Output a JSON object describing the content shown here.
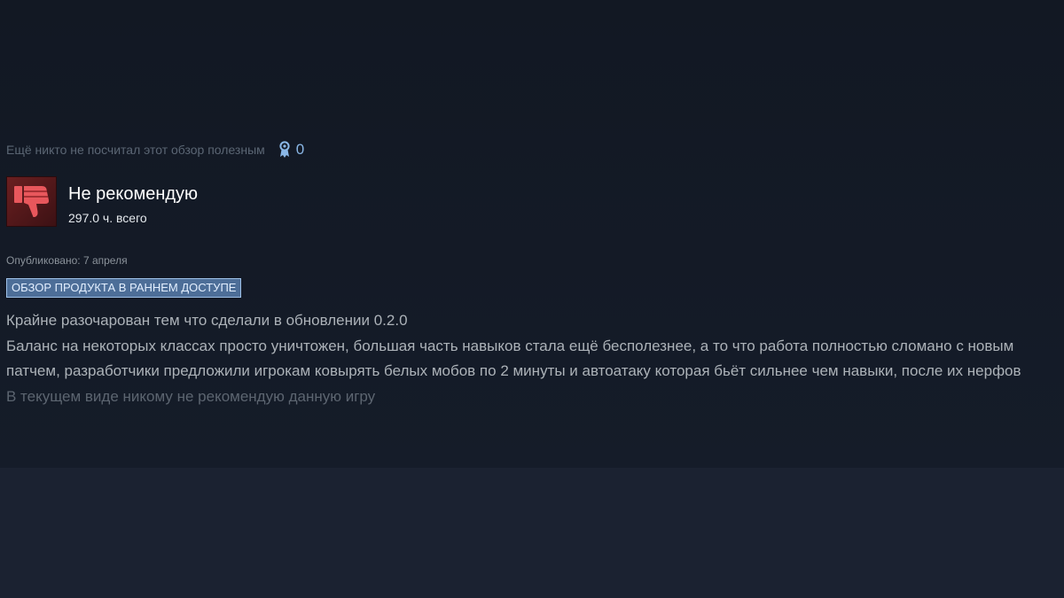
{
  "review": {
    "helpful_text": "Ещё никто не посчитал этот обзор полезным",
    "award_icon": "award-ribbon-icon",
    "award_count": "0",
    "verdict_icon": "thumbs-down-icon",
    "verdict": "Не рекомендую",
    "hours": "297.0 ч. всего",
    "published": "Опубликовано: 7 апреля",
    "badge": "ОБЗОР ПРОДУКТА В РАННЕМ ДОСТУПЕ",
    "body": [
      "Крайне разочарован тем что сделали в обновлении 0.2.0",
      "Баланс на некоторых классах просто уничтожен, большая часть навыков стала ещё бесполезнее, а то что работа полностью сломано с новым патчем, разработчики предложили игрокам ковырять белых мобов по 2 минуты и автоатаку которая бьёт сильнее чем навыки, после их нерфов",
      "В текущем виде никому не рекомендую данную игру"
    ]
  },
  "colors": {
    "background": "#121823",
    "negative": "#a43034",
    "badge_bg": "#4d6e98",
    "award": "#8ab7e6"
  }
}
